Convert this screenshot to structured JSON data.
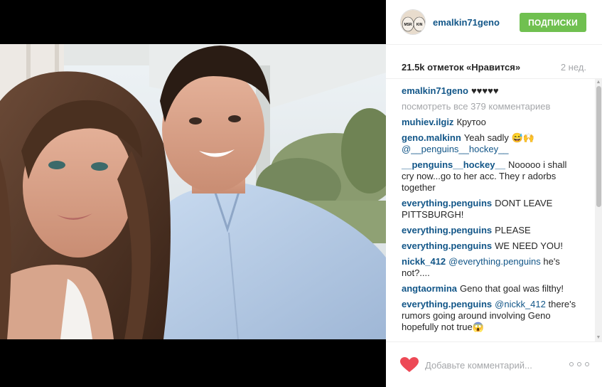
{
  "post": {
    "username": "emalkin71geno",
    "follow_label": "ПОДПИСКИ",
    "likes_text": "21.5k отметок «Нравится»",
    "time_ago": "2 нед.",
    "accent_color": "#125688",
    "follow_color": "#70c050"
  },
  "avatar_text": {
    "left": "MSR",
    "right": "KIN"
  },
  "caption": {
    "user": "emalkin71geno",
    "text": "♥♥♥♥♥"
  },
  "view_all_comments": "посмотреть все 379 комментариев",
  "comments": [
    {
      "user": "muhiev.ilgiz",
      "text": "Крутоо"
    },
    {
      "user": "geno.malkinn",
      "text": "Yeah sadly 😅🙌",
      "mention": "@__penguins__hockey__"
    },
    {
      "user": "__penguins__hockey__",
      "text": "Nooooo i shall cry now...go to her acc. They r adorbs together"
    },
    {
      "user": "everything.penguins",
      "text": "DONT LEAVE PITTSBURGH!"
    },
    {
      "user": "everything.penguins",
      "text": "PLEASE"
    },
    {
      "user": "everything.penguins",
      "text": "WE NEED YOU!"
    },
    {
      "user": "nickk_412",
      "mention": "@everything.penguins",
      "text": "he's not?...."
    },
    {
      "user": "angtaormina",
      "text": "Geno that goal was filthy!"
    },
    {
      "user": "everything.penguins",
      "mention": "@nickk_412",
      "text": "there's rumors going around involving Geno hopefully not true😱"
    }
  ],
  "footer": {
    "comment_placeholder": "Добавьте комментарий...",
    "heart_color": "#ed4956"
  },
  "icons": {
    "like": "heart-icon",
    "more": "more-options-icon"
  }
}
